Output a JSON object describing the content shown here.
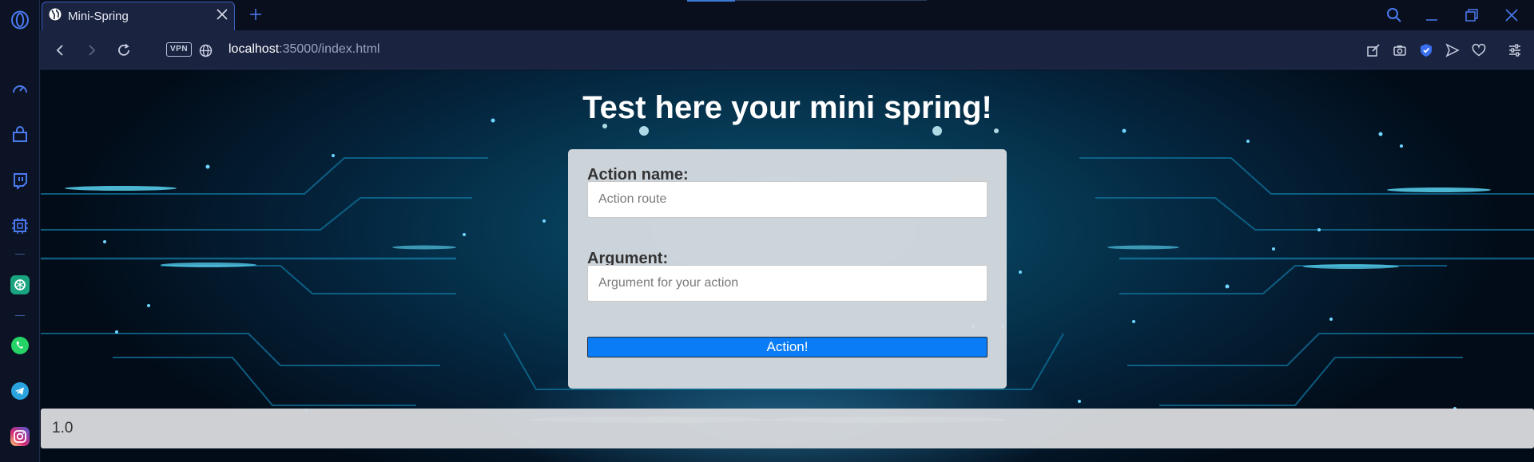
{
  "browser": {
    "tab": {
      "title": "Mini-Spring",
      "icon": "globe-icon"
    },
    "address": {
      "vpn_label": "VPN",
      "host": "localhost",
      "rest": ":35000/index.html"
    },
    "colors": {
      "accent": "#3a5fbf",
      "sidebar_bg": "#0c1324",
      "toolbar_bg": "#1a2340"
    }
  },
  "sidebar": {
    "items": [
      "opera-logo-icon",
      "speed-dial-icon",
      "shopping-bag-icon",
      "twitch-icon",
      "ai-chip-icon",
      "chatgpt-icon",
      "whatsapp-icon",
      "telegram-icon",
      "instagram-icon"
    ]
  },
  "page": {
    "title": "Test here your mini spring!",
    "form": {
      "action_label": "Action name:",
      "action_placeholder": "Action route",
      "argument_label": "Argument:",
      "argument_placeholder": "Argument for your action",
      "submit_label": "Action!"
    },
    "footer": {
      "text": "1.0"
    },
    "colors": {
      "button": "#0a7cf5",
      "card": "#d7dce2"
    }
  }
}
